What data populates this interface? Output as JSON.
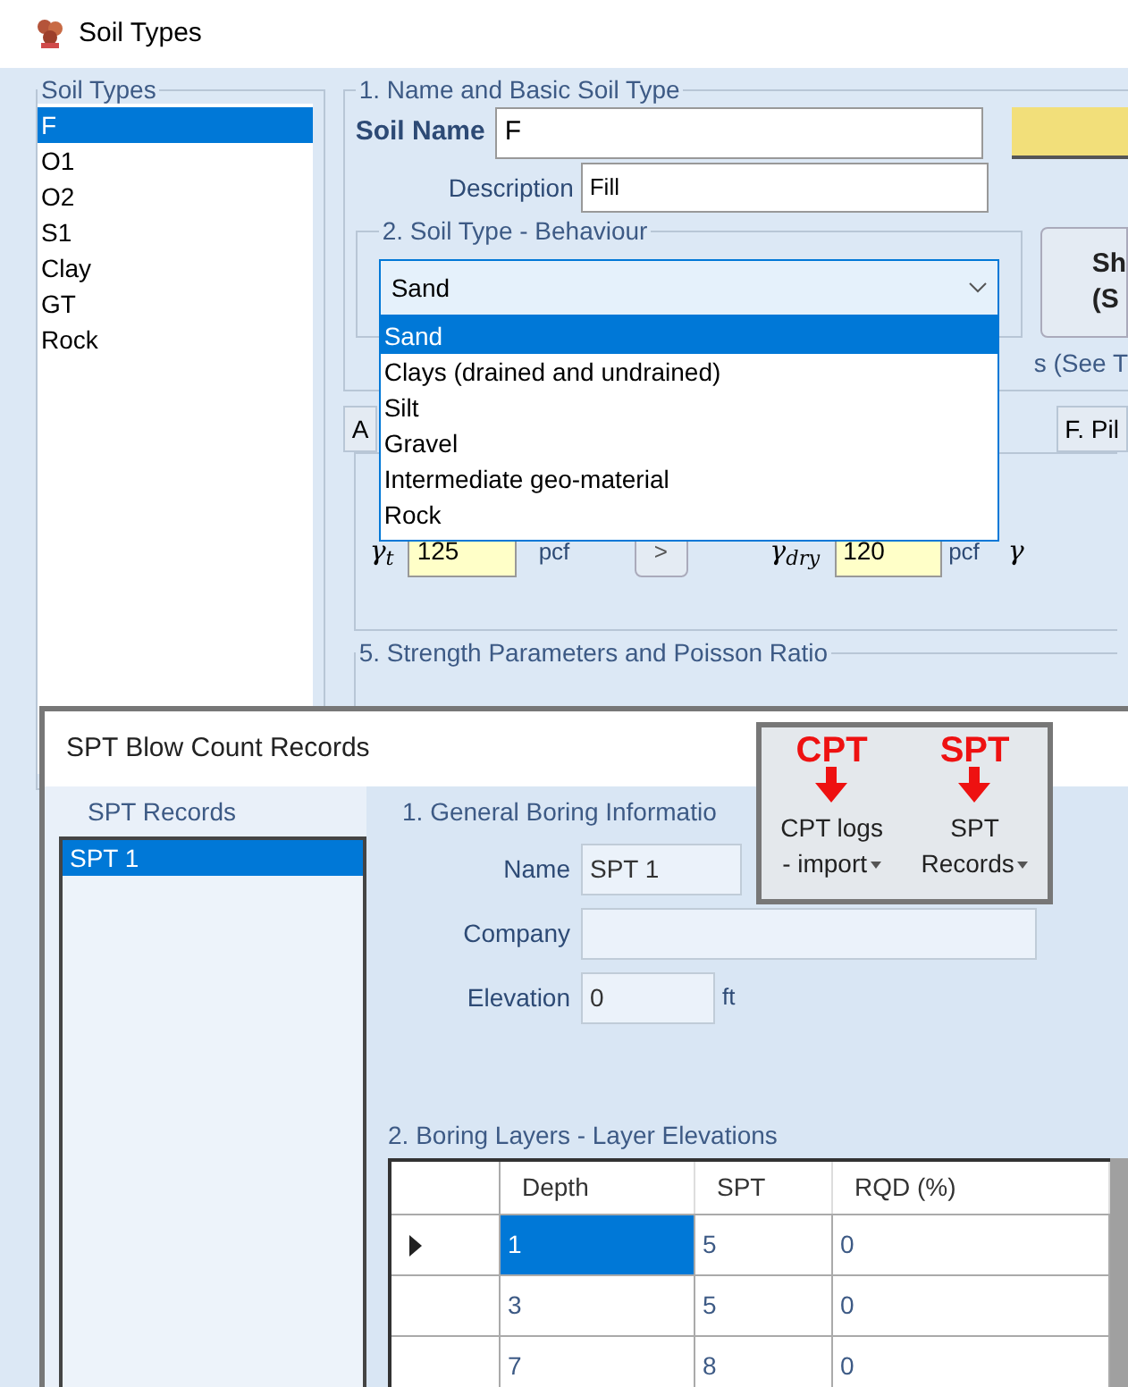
{
  "soil_window": {
    "title": "Soil Types",
    "soil_types": {
      "label": "Soil Types",
      "items": [
        {
          "label": "F",
          "selected": true
        },
        {
          "label": "O1",
          "selected": false
        },
        {
          "label": "O2",
          "selected": false
        },
        {
          "label": "S1",
          "selected": false
        },
        {
          "label": "Clay",
          "selected": false
        },
        {
          "label": "GT",
          "selected": false
        },
        {
          "label": "Rock",
          "selected": false
        }
      ]
    },
    "name_group": {
      "label": "1. Name and Basic Soil Type",
      "soil_name_label": "Soil Name",
      "soil_name": "F",
      "description_label": "Description",
      "description": "Fill"
    },
    "behaviour_group": {
      "label": "2. Soil Type - Behaviour",
      "value": "Sand",
      "expanded": true,
      "options": [
        {
          "label": "Sand",
          "selected": true
        },
        {
          "label": "Clays (drained and undrained)",
          "selected": false
        },
        {
          "label": "Silt",
          "selected": false
        },
        {
          "label": "Gravel",
          "selected": false
        },
        {
          "label": "Intermediate geo-material",
          "selected": false
        },
        {
          "label": "Rock",
          "selected": false
        }
      ]
    },
    "side_button": [
      "Sh",
      "(S"
    ],
    "note": "s (See T",
    "tabs": [
      "A",
      "F. Pil"
    ],
    "unit_weights": {
      "gamma_t": {
        "symbol": "γ",
        "sub": "t",
        "value": "125",
        "unit": "pcf"
      },
      "arrow_button": ">",
      "gamma_dry": {
        "symbol": "γ",
        "sub": "dry",
        "value": "120",
        "unit": "pcf"
      },
      "gamma_next": "γ"
    },
    "strength_group": {
      "label": "5. Strength Parameters and Poisson Ratio"
    }
  },
  "spt_window": {
    "title": "SPT Blow Count Records",
    "records": {
      "label": "SPT Records",
      "items": [
        {
          "label": "SPT 1",
          "selected": true
        }
      ]
    },
    "general": {
      "label": "1. General Boring Informatio",
      "name_label": "Name",
      "name": "SPT 1",
      "company_label": "Company",
      "elevation_label": "Elevation",
      "elevation": "0",
      "elevation_unit": "ft"
    },
    "toolbar": [
      {
        "badge": "CPT",
        "lines": [
          "CPT logs",
          "- import"
        ]
      },
      {
        "badge": "SPT",
        "lines": [
          "SPT",
          "Records"
        ]
      }
    ],
    "layers": {
      "label": "2. Boring Layers - Layer Elevations",
      "columns": [
        "Depth",
        "SPT",
        "RQD (%)"
      ],
      "rows": [
        {
          "cells": [
            "1",
            "5",
            "0"
          ],
          "selected": true
        },
        {
          "cells": [
            "3",
            "5",
            "0"
          ],
          "selected": false
        },
        {
          "cells": [
            "7",
            "8",
            "0"
          ],
          "selected": false
        }
      ]
    }
  }
}
